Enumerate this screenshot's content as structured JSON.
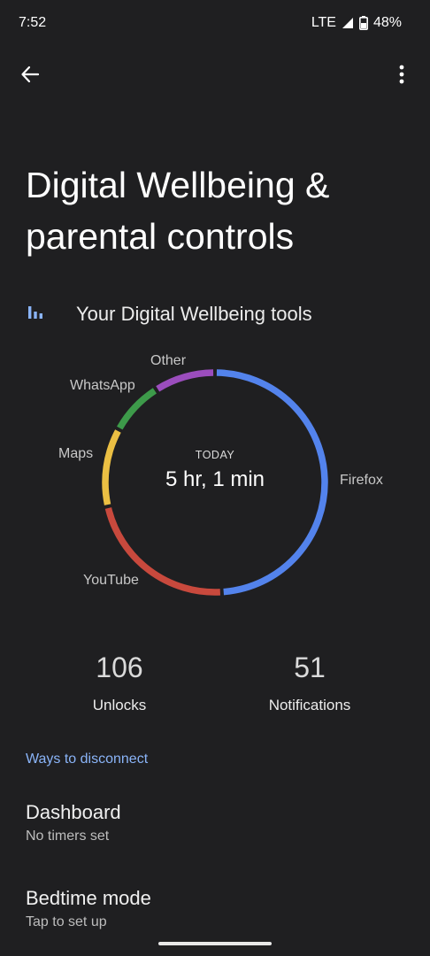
{
  "status_bar": {
    "time": "7:52",
    "network": "LTE",
    "battery": "48%"
  },
  "top_bar": {
    "back_icon": "arrow-back-icon",
    "menu_icon": "more-vert-icon"
  },
  "page": {
    "title": "Digital Wellbeing & parental controls"
  },
  "section": {
    "icon": "bar-chart-icon",
    "label": "Your Digital Wellbeing tools"
  },
  "usage": {
    "period_label": "TODAY",
    "total": "5 hr, 1 min",
    "chart_data": {
      "type": "pie",
      "donut": true,
      "slices": [
        {
          "label": "Firefox",
          "fraction": 0.49,
          "color": "#5383ec"
        },
        {
          "label": "YouTube",
          "fraction": 0.225,
          "color": "#c8493d"
        },
        {
          "label": "Maps",
          "fraction": 0.115,
          "color": "#ebbf43"
        },
        {
          "label": "WhatsApp",
          "fraction": 0.08,
          "color": "#3d9a4a"
        },
        {
          "label": "Other",
          "fraction": 0.09,
          "color": "#9b4dbd"
        }
      ]
    }
  },
  "stats": {
    "unlocks": {
      "value": "106",
      "label": "Unlocks"
    },
    "notifications": {
      "value": "51",
      "label": "Notifications"
    }
  },
  "ways": {
    "header": "Ways to disconnect"
  },
  "items": [
    {
      "title": "Dashboard",
      "subtitle": "No timers set"
    },
    {
      "title": "Bedtime mode",
      "subtitle": "Tap to set up"
    }
  ],
  "colors": {
    "background": "#1f1f21",
    "accent": "#8ab4f8"
  }
}
